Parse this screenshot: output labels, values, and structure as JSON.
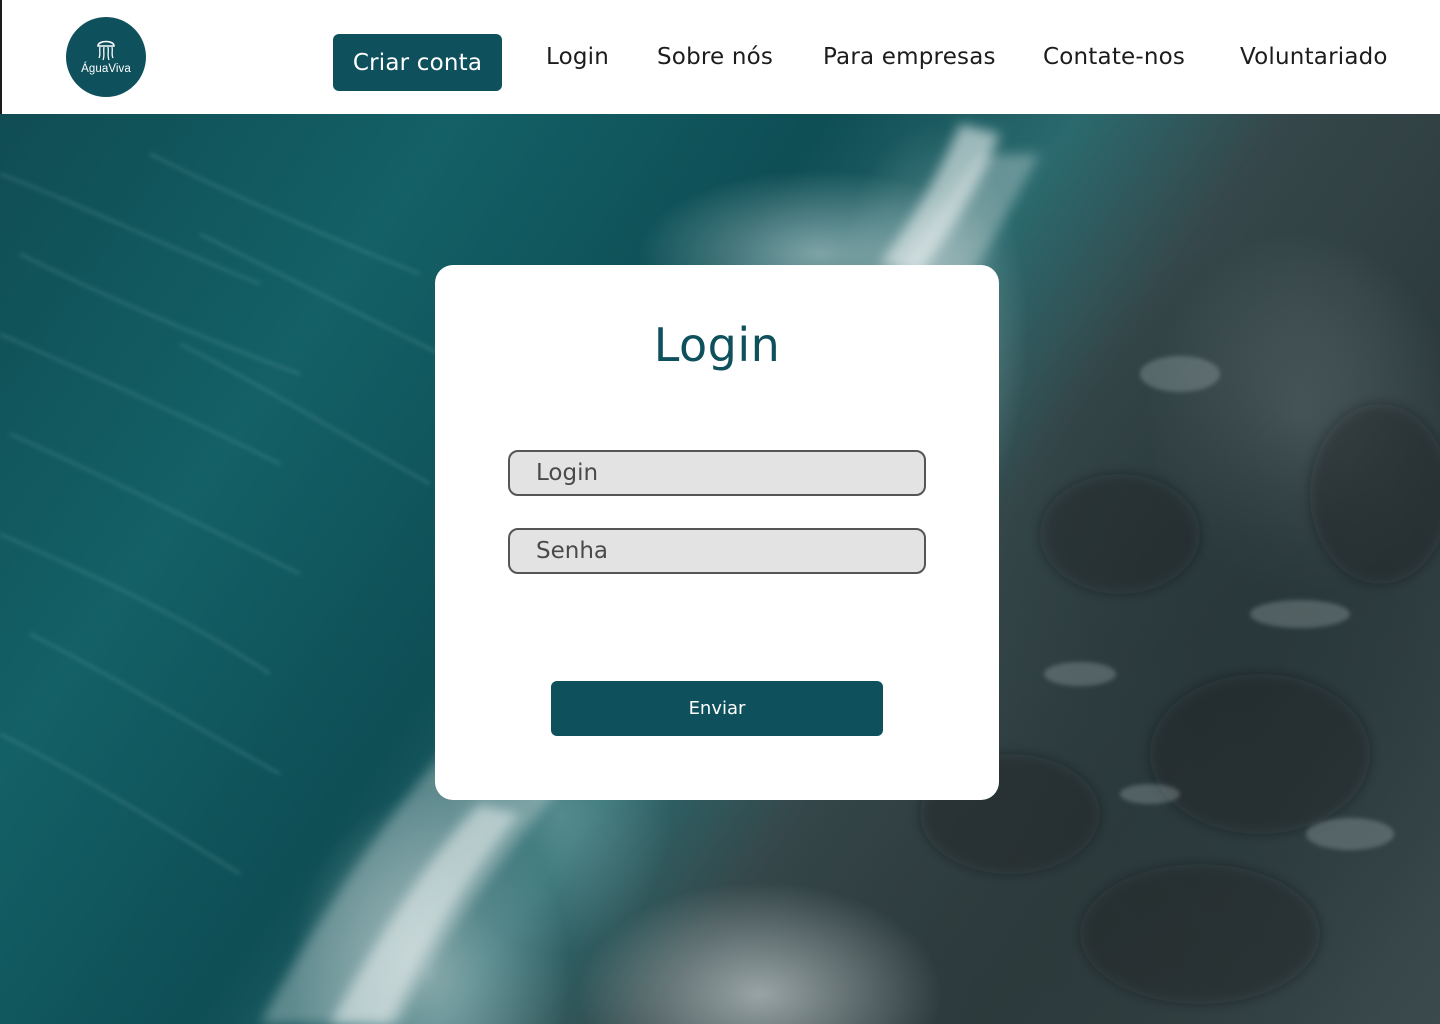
{
  "brand": {
    "name": "ÁguaViva",
    "logo_icon": "jellyfish-icon",
    "primary_color": "#0e505c"
  },
  "nav": {
    "cta_label": "Criar conta",
    "links": [
      "Login",
      "Sobre nós",
      "Para empresas",
      "Contate-nos",
      "Voluntariado"
    ]
  },
  "login_form": {
    "title": "Login",
    "login_placeholder": "Login",
    "password_placeholder": "Senha",
    "submit_label": "Enviar"
  }
}
